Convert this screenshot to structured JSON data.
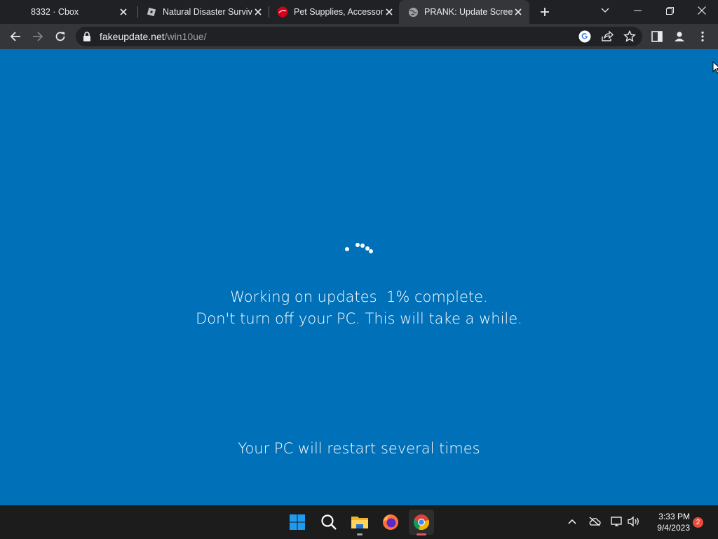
{
  "browser": {
    "tabs": [
      {
        "title": "8332 · Cbox",
        "favicon": "none",
        "active": false
      },
      {
        "title": "Natural Disaster Survival",
        "favicon": "roblox-icon",
        "active": false
      },
      {
        "title": "Pet Supplies, Accessories",
        "favicon": "petco-icon",
        "active": false
      },
      {
        "title": "PRANK: Update Screen",
        "favicon": "globe-icon",
        "active": true
      }
    ],
    "url_domain": "fakeupdate.net",
    "url_path": "/win10ue/"
  },
  "page": {
    "line1": "Working on updates  1% complete.",
    "line2": "Don't turn off your PC. This will take a while.",
    "line3": "Your PC will restart several times",
    "background_color": "#0070b8"
  },
  "taskbar": {
    "apps": [
      "windows-start-icon",
      "search-icon",
      "file-explorer-icon",
      "firefox-icon",
      "chrome-icon"
    ],
    "time": "3:33 PM",
    "date": "9/4/2023",
    "notification_count": "2"
  }
}
